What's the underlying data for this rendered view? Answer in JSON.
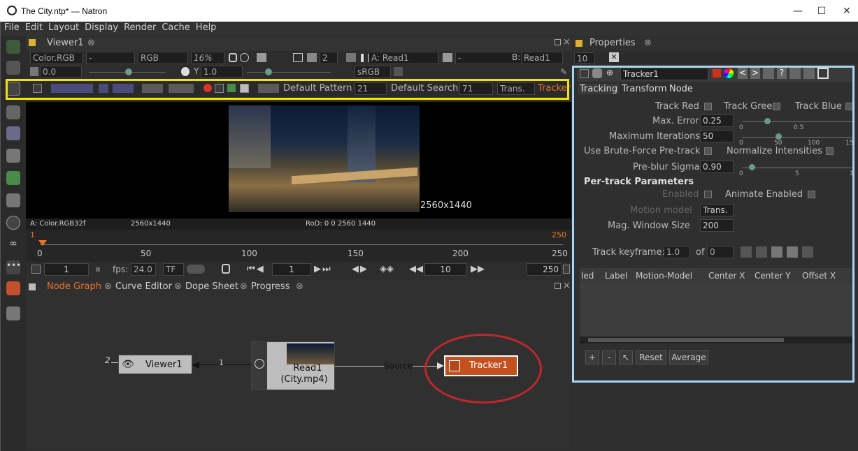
{
  "window": {
    "title": "The City.ntp* — Natron",
    "minimize": "—",
    "maximize": "☐",
    "close": "✕"
  },
  "menu": [
    "File",
    "Edit",
    "Layout",
    "Display",
    "Render",
    "Cache",
    "Help"
  ],
  "viewer_tab": {
    "label": "Viewer1"
  },
  "viewer_bar": {
    "layer": "Color.RGB",
    "alpha": "-",
    "channels": "RGB",
    "zoom": "16%",
    "frame_chip": "2",
    "input_a": "A: Read1",
    "input_b_prefix": "B:",
    "input_b": "Read1",
    "wipe": "-",
    "gain": "0.0",
    "gamma_label": "Y",
    "gamma": "1.0",
    "colorspace": "sRGB"
  },
  "tracker_bar": {
    "default_pattern_label": "Default Pattern",
    "default_pattern": "21",
    "default_search_label": "Default Search /",
    "default_search": "71",
    "motion": "Trans.",
    "tracker_label": "Tracker"
  },
  "viewer": {
    "format": "2560x1440",
    "info_layer": "A: Color.RGB32f",
    "info_size": "2560x1440",
    "info_rod": "RoD: 0 0 2560 1440"
  },
  "timeline": {
    "current": "1",
    "end_marker": "250",
    "ticks": [
      "0",
      "50",
      "100",
      "150",
      "200",
      "250"
    ],
    "start": "1",
    "fps_label": "fps:",
    "fps": "24.0",
    "tf": "TF",
    "frame": "1",
    "step": "10",
    "end": "250"
  },
  "node_tabs": [
    "Node Graph",
    "Curve Editor",
    "Dope Sheet",
    "Progress"
  ],
  "nodes": {
    "viewer": "Viewer1",
    "viewer_input": "2",
    "viewer_link": "1",
    "read_line1": "Read1",
    "read_line2": "(City.mp4)",
    "tracker": "Tracker1",
    "edge": "Source"
  },
  "props": {
    "tab": "Properties",
    "max_panels": "10",
    "node_name": "Tracker1",
    "tabs": [
      "Tracking",
      "Transform",
      "Node"
    ],
    "track_red": "Track Red",
    "track_green": "Track Gree",
    "track_blue": "Track Blue",
    "max_error_label": "Max. Error",
    "max_error": "0.25",
    "max_error_ticks": [
      "0",
      "0.5"
    ],
    "max_iter_label": "Maximum Iterations",
    "max_iter": "50",
    "max_iter_ticks": [
      "0",
      "50",
      "100",
      "15"
    ],
    "brute_label": "Use Brute-Force Pre-track",
    "normalize_label": "Normalize Intensities",
    "preblur_label": "Pre-blur Sigma",
    "preblur": "0.90",
    "preblur_ticks": [
      "0",
      "5",
      "1"
    ],
    "per_track": "Per-track Parameters",
    "enabled_label": "Enabled",
    "animate_label": "Animate Enabled",
    "motion_label": "Motion model",
    "motion": "Trans.",
    "mag_label": "Mag. Window Size",
    "mag": "200",
    "keyframe_label": "Track keyframe:",
    "keyframe": "1.0",
    "of_label": "of",
    "of": "0",
    "columns": [
      "led",
      "Label",
      "Motion-Model",
      "Center X",
      "Center Y",
      "Offset X"
    ],
    "plus": "+",
    "minus": "-",
    "reset": "Reset",
    "average": "Average"
  },
  "colors": {
    "accent": "#e8732a",
    "highlight_yellow": "#f2e400",
    "highlight_blue": "#a9d4f2",
    "circle": "#c0272d",
    "tracker_fill": "#c4501e"
  }
}
